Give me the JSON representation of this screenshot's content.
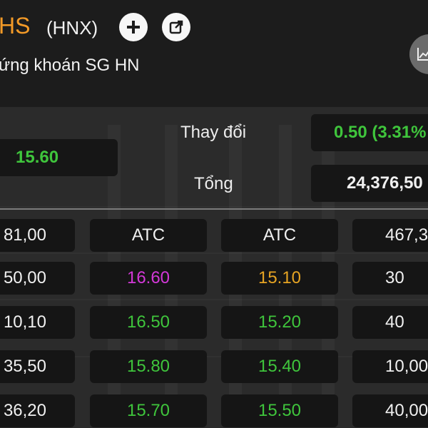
{
  "header": {
    "symbol": "HS",
    "exchange": "(HNX)",
    "company": "ứng khoán SG HN"
  },
  "summary": {
    "price": "15.60",
    "change_label": "Thay đổi",
    "change_value": "0.50 (3.31%",
    "total_label": "Tổng",
    "total_value": "24,376,50"
  },
  "order_book": [
    {
      "bid_volume": "81,00",
      "bid_price": "ATC",
      "ask_price": "ATC",
      "ask_volume": "467,3"
    },
    {
      "bid_volume": "50,00",
      "bid_price": "16.60",
      "ask_price": "15.10",
      "ask_volume": "30"
    },
    {
      "bid_volume": "10,10",
      "bid_price": "16.50",
      "ask_price": "15.20",
      "ask_volume": "40"
    },
    {
      "bid_volume": "35,50",
      "bid_price": "15.80",
      "ask_price": "15.40",
      "ask_volume": "10,00"
    },
    {
      "bid_volume": "36,20",
      "bid_price": "15.70",
      "ask_price": "15.50",
      "ask_volume": "40,00"
    }
  ],
  "colors": {
    "accent": "#f39a27",
    "up": "#3fc53c",
    "ceiling": "#d338d8",
    "reference": "#e6a423"
  },
  "icons": [
    "plus-icon",
    "external-link-icon",
    "chart-icon"
  ]
}
